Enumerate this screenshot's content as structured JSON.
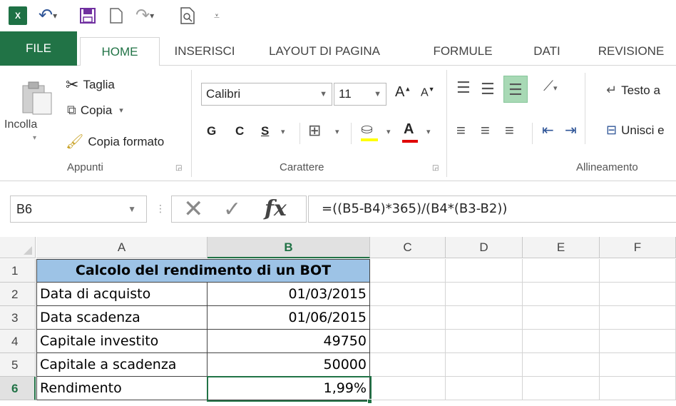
{
  "app": {
    "logo_text": "X",
    "colors": {
      "accent": "#217346",
      "header_fill": "#9DC3E6"
    }
  },
  "quick_access": {
    "icons": [
      "excel-logo",
      "undo-icon",
      "save-icon",
      "new-document-icon",
      "redo-icon",
      "print-preview-icon",
      "customize-qat-icon"
    ]
  },
  "tabs": [
    "FILE",
    "HOME",
    "INSERISCI",
    "LAYOUT DI PAGINA",
    "FORMULE",
    "DATI",
    "REVISIONE"
  ],
  "active_tab": "HOME",
  "ribbon": {
    "clipboard": {
      "paste": "Incolla",
      "cut": "Taglia",
      "copy": "Copia",
      "format_painter": "Copia formato",
      "label": "Appunti"
    },
    "font": {
      "name": "Calibri",
      "size": "11",
      "bold": "G",
      "italic": "C",
      "underline": "S",
      "text_color_letter": "A",
      "grow_letter": "A",
      "shrink_letter": "A",
      "label": "Carattere"
    },
    "alignment": {
      "wrap_text": "Testo a",
      "merge": "Unisci e",
      "label": "Allineamento"
    }
  },
  "formula_bar": {
    "name_box": "B6",
    "formula": "=((B5-B4)*365)/(B4*(B3-B2))",
    "fx": "fx"
  },
  "sheet": {
    "columns": [
      "A",
      "B",
      "C",
      "D",
      "E",
      "F"
    ],
    "selected_column": "B",
    "rows": [
      "1",
      "2",
      "3",
      "4",
      "5",
      "6"
    ],
    "selected_row": "6",
    "title": "Calcolo del rendimento di un BOT",
    "data": [
      {
        "label": "Data di acquisto",
        "value": "01/03/2015"
      },
      {
        "label": "Data scadenza",
        "value": "01/06/2015"
      },
      {
        "label": "Capitale investito",
        "value": "49750"
      },
      {
        "label": "Capitale a scadenza",
        "value": "50000"
      },
      {
        "label": "Rendimento",
        "value": "1,99%"
      }
    ]
  }
}
